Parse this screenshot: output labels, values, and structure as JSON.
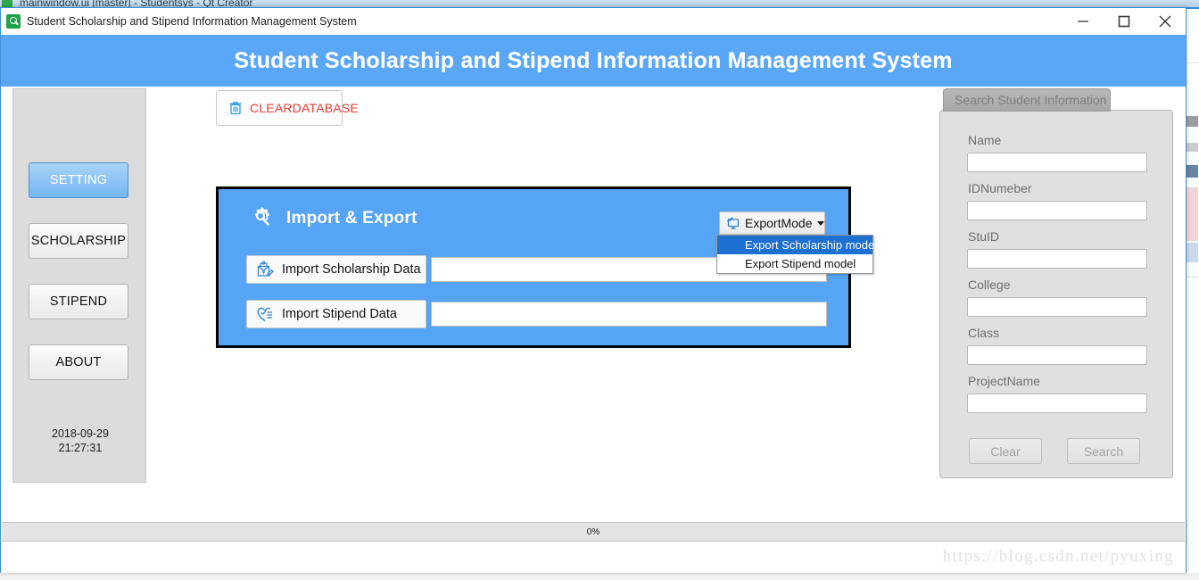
{
  "background": {
    "ide_title": "mainwindow.ui [master] - Studentsys - Qt Creator",
    "app_icon": "magnifier-green-icon"
  },
  "window": {
    "titlebar": {
      "icon": "app-magnifier-icon",
      "title": "Student Scholarship and Stipend Information Management System",
      "minimize_label": "minimize-icon",
      "maximize_label": "maximize-icon",
      "close_label": "close-icon"
    },
    "banner": {
      "title": "Student Scholarship and Stipend Information Management System",
      "background_color": "#5aa7f7",
      "text_color": "#ffffff"
    }
  },
  "sidebar": {
    "background_color": "#dcdcdc",
    "buttons": [
      {
        "label": "SETTING",
        "active": true
      },
      {
        "label": "SCHOLARSHIP",
        "active": false
      },
      {
        "label": "STIPEND",
        "active": false
      },
      {
        "label": "ABOUT",
        "active": false
      }
    ],
    "clock": {
      "date": "2018-09-29",
      "time": "21:27:31"
    }
  },
  "toolbar": {
    "clear_database": {
      "label": "CLEARDATABASE",
      "icon": "trash-icon",
      "text_color": "#ec3a33"
    }
  },
  "import_export": {
    "title": "Import & Export",
    "icon": "gear-magnifier-icon",
    "panel_color": "#55a4f5",
    "export_mode": {
      "label": "ExportMode",
      "icon": "monitor-export-icon",
      "menu_open": true,
      "menu_items": [
        {
          "label": "Export Scholarship model",
          "selected": true
        },
        {
          "label": "Export Stipend model",
          "selected": false
        }
      ]
    },
    "rows": [
      {
        "button_label": "Import Scholarship Data",
        "button_icon": "scholarship-import-icon",
        "field_value": "",
        "field_placeholder": ""
      },
      {
        "button_label": "Import  Stipend  Data",
        "button_icon": "stipend-heart-icon",
        "field_value": "",
        "field_placeholder": ""
      }
    ]
  },
  "search_panel": {
    "group_title": "Search Student Information",
    "fields": [
      {
        "label": "Name",
        "value": "",
        "placeholder": ""
      },
      {
        "label": "IDNumeber",
        "value": "",
        "placeholder": ""
      },
      {
        "label": "StuID",
        "value": "",
        "placeholder": ""
      },
      {
        "label": "College",
        "value": "",
        "placeholder": ""
      },
      {
        "label": "Class",
        "value": "",
        "placeholder": ""
      },
      {
        "label": "ProjectName",
        "value": "",
        "placeholder": ""
      }
    ],
    "buttons": [
      {
        "label": "Clear"
      },
      {
        "label": "Search"
      }
    ]
  },
  "statusbar": {
    "progress_text": "0%",
    "progress_value": 0,
    "watermark": "https://blog.csdn.net/pyuxing"
  }
}
